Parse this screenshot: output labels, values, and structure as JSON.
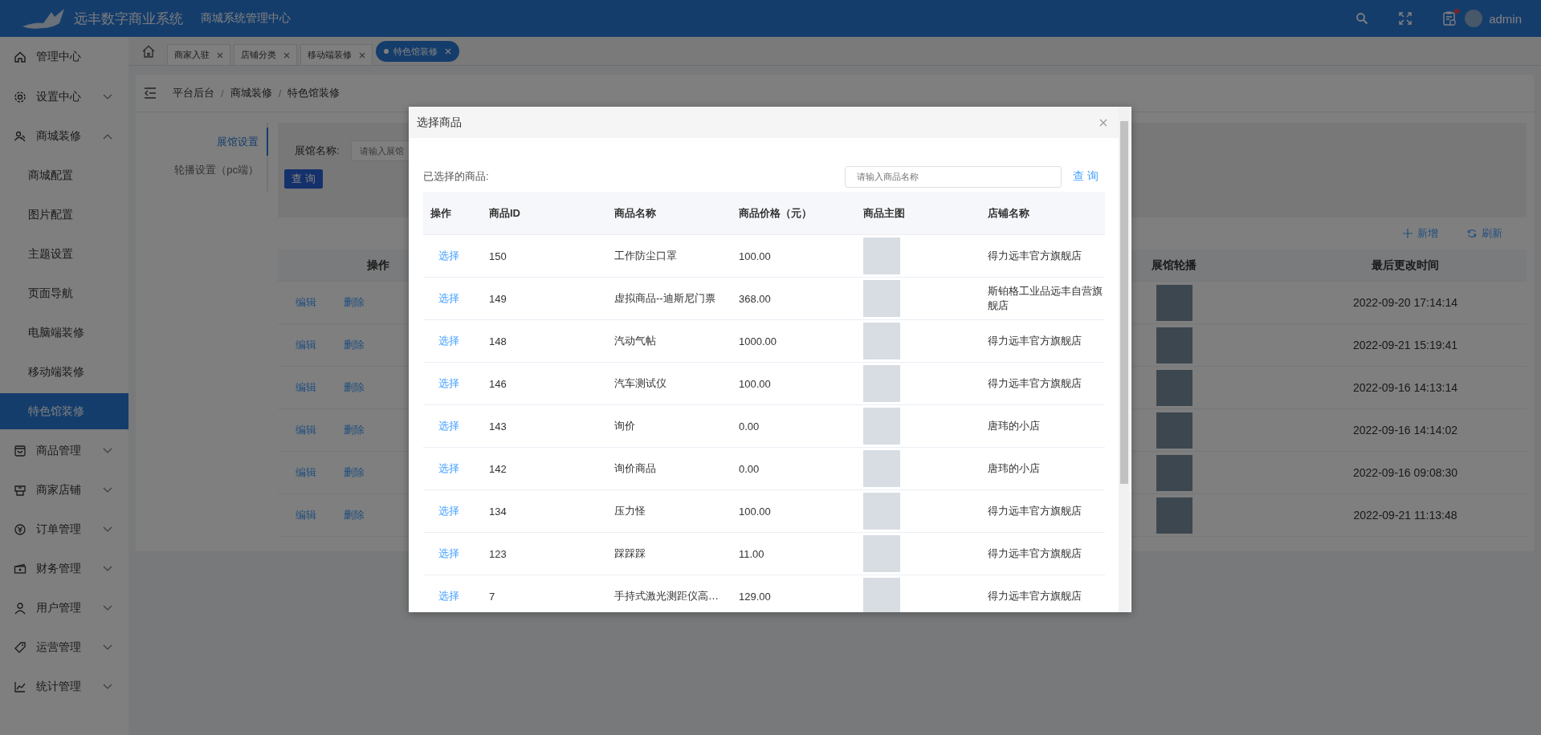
{
  "header": {
    "brand": "远丰数字商业系统",
    "subtitle": "商城系统管理中心",
    "user": "admin",
    "has_notification": true
  },
  "sidebar": {
    "items": [
      {
        "label": "管理中心",
        "selected": false
      },
      {
        "label": "设置中心",
        "selected": false,
        "expanded": false
      },
      {
        "label": "商城装修",
        "selected": false,
        "expanded": true,
        "children": [
          {
            "label": "商城配置",
            "selected": false
          },
          {
            "label": "图片配置",
            "selected": false
          },
          {
            "label": "主题设置",
            "selected": false
          },
          {
            "label": "页面导航",
            "selected": false
          },
          {
            "label": "电脑端装修",
            "selected": false
          },
          {
            "label": "移动端装修",
            "selected": false
          },
          {
            "label": "特色馆装修",
            "selected": true
          }
        ]
      },
      {
        "label": "商品管理",
        "selected": false,
        "expanded": false
      },
      {
        "label": "商家店铺",
        "selected": false,
        "expanded": false
      },
      {
        "label": "订单管理",
        "selected": false,
        "expanded": false
      },
      {
        "label": "财务管理",
        "selected": false,
        "expanded": false
      },
      {
        "label": "用户管理",
        "selected": false,
        "expanded": false
      },
      {
        "label": "运营管理",
        "selected": false,
        "expanded": false
      },
      {
        "label": "统计管理",
        "selected": false,
        "expanded": false
      }
    ]
  },
  "tabs": [
    {
      "label": "商家入驻",
      "selected": false
    },
    {
      "label": "店铺分类",
      "selected": false
    },
    {
      "label": "移动端装修",
      "selected": false
    },
    {
      "label": "特色馆装修",
      "selected": true
    }
  ],
  "breadcrumb": {
    "separator": "/",
    "items": [
      "平台后台",
      "商城装修",
      "特色馆装修"
    ]
  },
  "side_tabs": [
    {
      "label": "展馆设置",
      "selected": true
    },
    {
      "label": "轮播设置（pc端）",
      "selected": false
    }
  ],
  "filter": {
    "label": "展馆名称:",
    "placeholder": "请输入展馆",
    "button": "查 询"
  },
  "toolbar": {
    "add": "新增",
    "refresh": "刷新"
  },
  "table": {
    "columns": [
      "操作",
      "展馆轮播",
      "最后更改时间"
    ],
    "rows": [
      {
        "actions": [
          "编辑",
          "删除"
        ],
        "time": "2022-09-20 17:14:14"
      },
      {
        "actions": [
          "编辑",
          "删除"
        ],
        "time": "2022-09-21 15:19:41"
      },
      {
        "actions": [
          "编辑",
          "删除"
        ],
        "time": "2022-09-16 14:13:14"
      },
      {
        "actions": [
          "编辑",
          "删除"
        ],
        "time": "2022-09-16 14:14:02"
      },
      {
        "actions": [
          "编辑",
          "删除"
        ],
        "time": "2022-09-16 09:08:30"
      },
      {
        "actions": [
          "编辑",
          "删除"
        ],
        "time": "2022-09-21 11:13:48"
      }
    ]
  },
  "modal": {
    "title": "选择商品",
    "selected_label": "已选择的商品:",
    "search_placeholder": "请输入商品名称",
    "search_button": "查 询",
    "columns": [
      "操作",
      "商品ID",
      "商品名称",
      "商品价格（元）",
      "商品主图",
      "店铺名称"
    ],
    "rows": [
      {
        "action": "选择",
        "id": "150",
        "name": "工作防尘口罩",
        "price": "100.00",
        "shop": "得力远丰官方旗舰店"
      },
      {
        "action": "选择",
        "id": "149",
        "name": "虚拟商品--迪斯尼门票",
        "price": "368.00",
        "shop": "斯铂格工业品远丰自营旗舰店"
      },
      {
        "action": "选择",
        "id": "148",
        "name": "汽动气帖",
        "price": "1000.00",
        "shop": "得力远丰官方旗舰店"
      },
      {
        "action": "选择",
        "id": "146",
        "name": "汽车测试仪",
        "price": "100.00",
        "shop": "得力远丰官方旗舰店"
      },
      {
        "action": "选择",
        "id": "143",
        "name": "询价",
        "price": "0.00",
        "shop": "唐玮的小店"
      },
      {
        "action": "选择",
        "id": "142",
        "name": "询价商品",
        "price": "0.00",
        "shop": "唐玮的小店"
      },
      {
        "action": "选择",
        "id": "134",
        "name": "压力怪",
        "price": "100.00",
        "shop": "得力远丰官方旗舰店"
      },
      {
        "action": "选择",
        "id": "123",
        "name": "踩踩踩",
        "price": "11.00",
        "shop": "得力远丰官方旗舰店"
      },
      {
        "action": "选择",
        "id": "7",
        "name": "手持式激光测距仪高…",
        "price": "129.00",
        "shop": "得力远丰官方旗舰店"
      }
    ]
  }
}
